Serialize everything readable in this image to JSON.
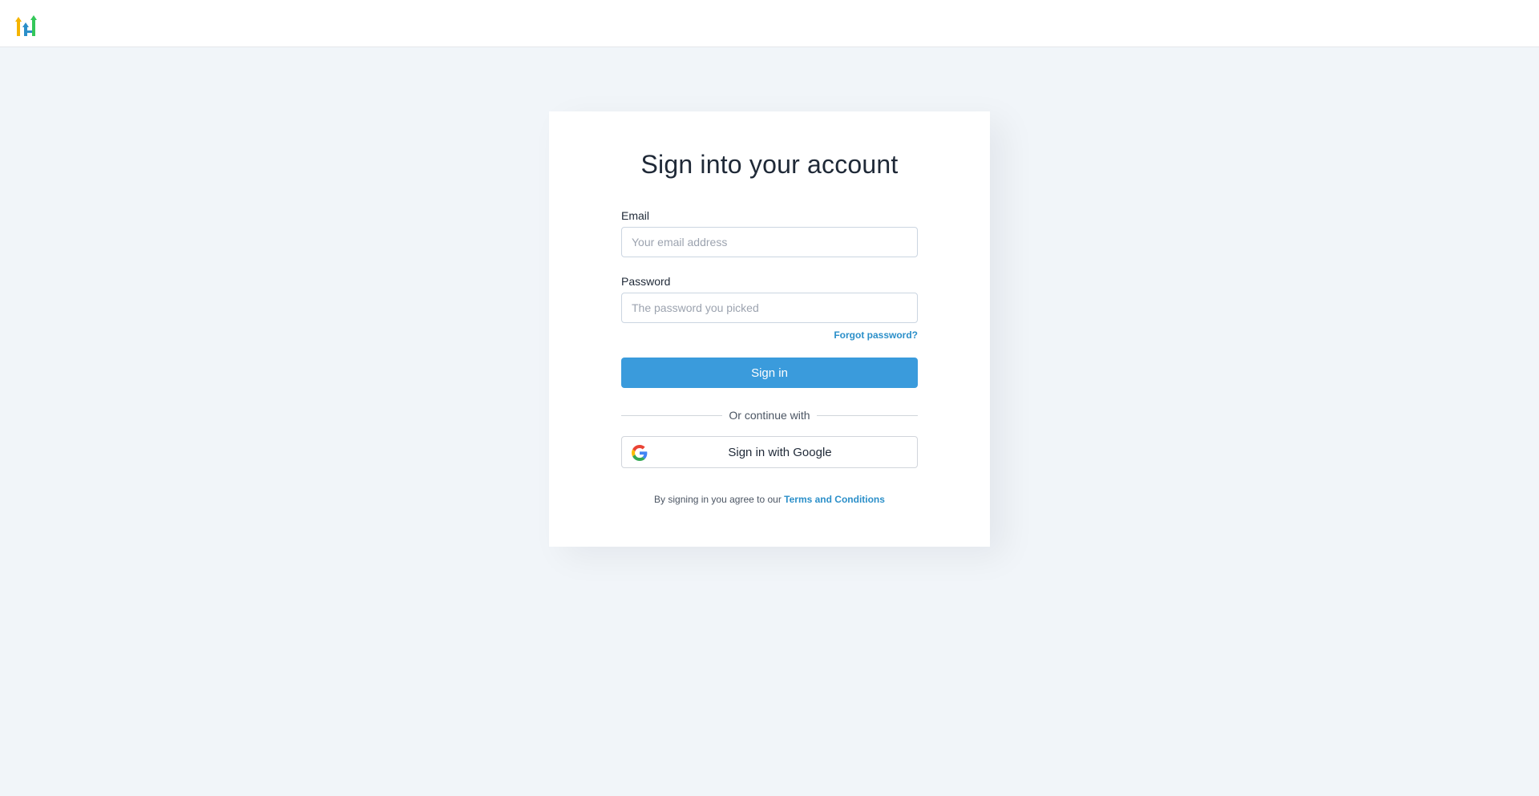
{
  "header": {
    "logo_icon": "gofundme-arrows-logo",
    "logo_colors": [
      "#f5b400",
      "#2b8fc9",
      "#34c759"
    ]
  },
  "login": {
    "title": "Sign into your account",
    "email_label": "Email",
    "email_placeholder": "Your email address",
    "email_value": "",
    "password_label": "Password",
    "password_placeholder": "The password you picked",
    "password_value": "",
    "forgot_password": "Forgot password?",
    "signin_button": "Sign in",
    "divider_text": "Or continue with",
    "google_button": "Sign in with Google",
    "google_icon": "google-g-icon",
    "terms_prefix": "By signing in you agree to our ",
    "terms_link": "Terms and Conditions"
  },
  "colors": {
    "page_background": "#f1f5f9",
    "accent": "#3a9bdc",
    "link": "#2b8fc9"
  }
}
